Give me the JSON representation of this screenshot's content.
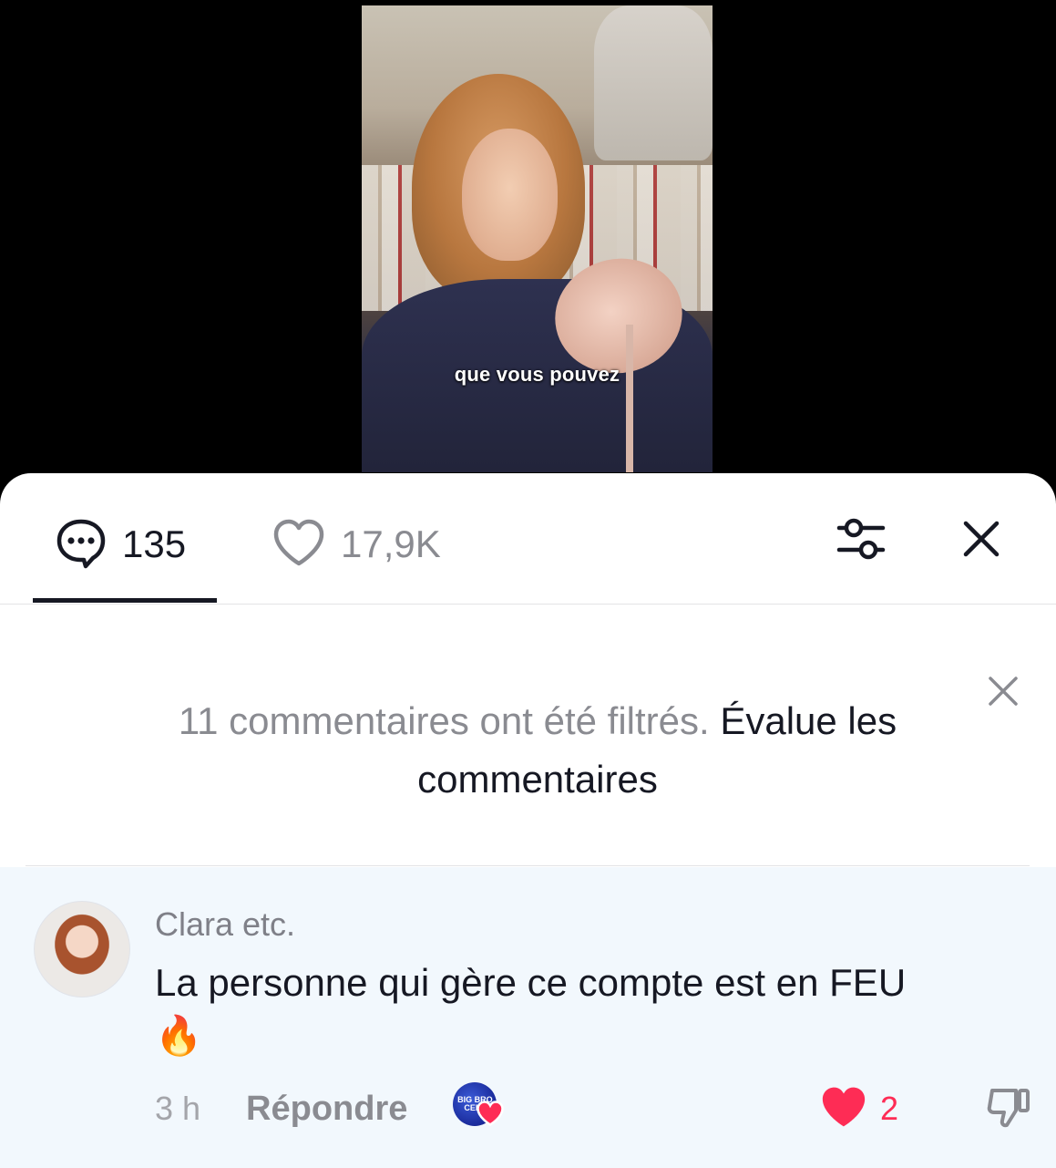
{
  "video": {
    "subtitle": "que vous pouvez"
  },
  "sheet": {
    "tabs": {
      "comments_count": "135",
      "likes_count": "17,9K",
      "icons": {
        "comments": "comment-bubble-icon",
        "likes": "heart-outline-icon",
        "filter": "sliders-icon",
        "close": "close-icon"
      }
    },
    "notice": {
      "text": "11 commentaires ont été filtrés.",
      "link": "Évalue les commentaires"
    },
    "comment": {
      "username": "Clara etc.",
      "text": "La personne qui gère ce compte est en FEU",
      "emoji": "🔥",
      "time": "3 h",
      "reply_label": "Répondre",
      "creator_badge_text": "BIG BRO CELE",
      "likes": "2"
    }
  },
  "colors": {
    "accent": "#fe2c55",
    "text": "#161823",
    "muted": "#8a8b91",
    "comment_bg": "#f2f8fd"
  }
}
